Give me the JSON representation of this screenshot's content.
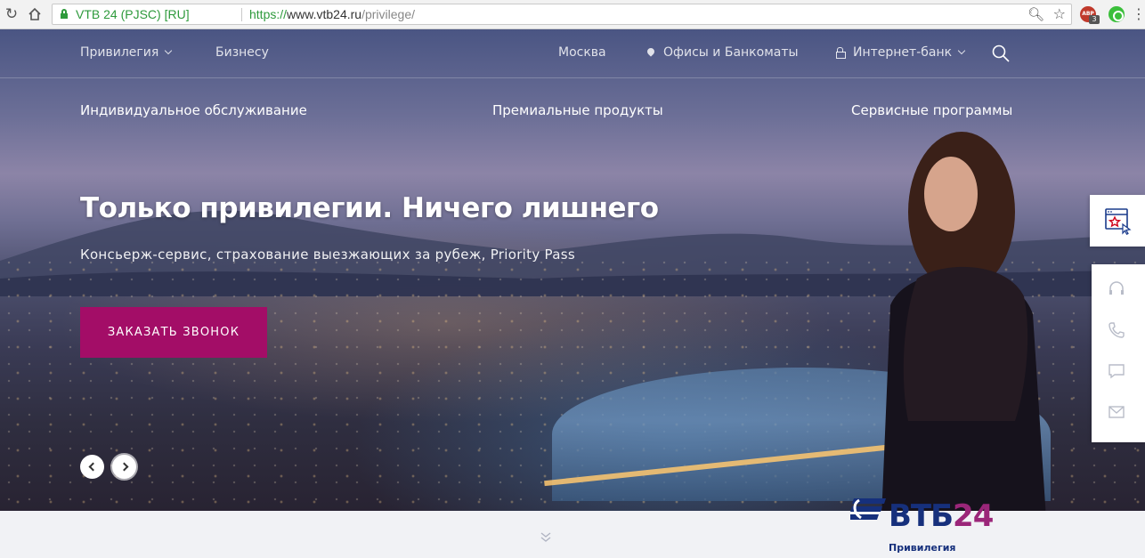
{
  "browser": {
    "site_identity": "VTB 24 (PJSC) [RU]",
    "url_scheme": "https://",
    "url_host": "www.vtb24.ru",
    "url_path": "/privilege/",
    "extension_badge": "3",
    "extension_label": "ABP",
    "icons": [
      "back-icon",
      "reload-icon",
      "home-icon",
      "lock-icon",
      "zoom-icon",
      "star-icon"
    ]
  },
  "topnav": {
    "privilege": "Привилегия",
    "business": "Бизнесу",
    "city": "Москва",
    "offices": "Офисы и Банкоматы",
    "internet_bank": "Интернет-банк"
  },
  "subnav": {
    "individual": "Индивидуальное обслуживание",
    "premium": "Премиальные продукты",
    "service": "Сервисные программы"
  },
  "hero": {
    "title": "Только привилегии. Ничего лишнего",
    "subtitle": "Консьерж-сервис, страхование выезжающих за рубеж, Priority Pass",
    "cta": "ЗАКАЗАТЬ ЗВОНОК"
  },
  "logo": {
    "vtb": "ВТБ",
    "number": "24",
    "caption": "Привилегия"
  },
  "colors": {
    "brand_magenta": "#a30d67",
    "brand_navy": "#16307c",
    "secure_green": "#2e9a3c"
  }
}
